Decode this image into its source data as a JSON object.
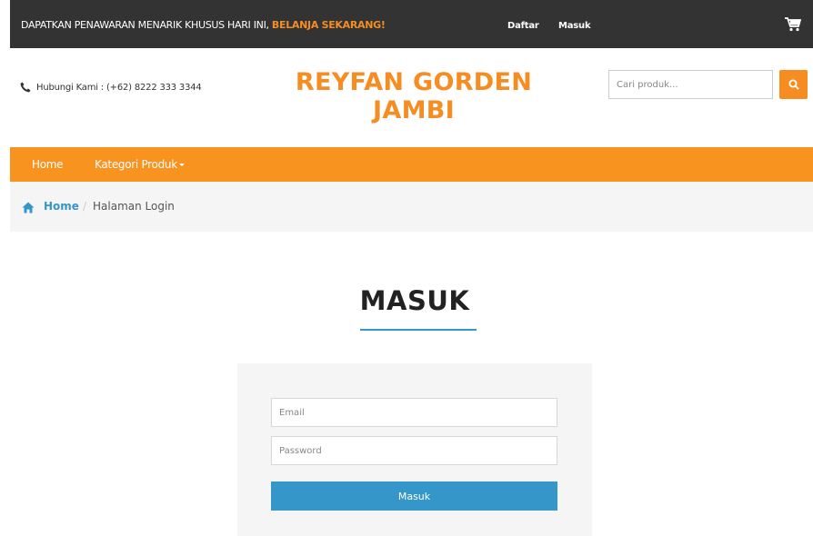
{
  "topbar": {
    "promo_text": "DAPATKAN PENAWARAN MENARIK KHUSUS HARI INI, ",
    "promo_cta": "BELANJA SEKARANG!",
    "register_label": "Daftar",
    "login_label": "Masuk",
    "cart_icon": "cart-icon"
  },
  "header": {
    "phone_icon": "phone-icon",
    "contact_text": "Hubungi Kami : (+62) 8222 333 3344",
    "brand_line1": "REYFAN GORDEN",
    "brand_line2": "JAMBI",
    "search_placeholder": "Cari produk...",
    "search_icon": "search-icon"
  },
  "nav": {
    "items": [
      {
        "label": "Home"
      },
      {
        "label": "Kategori Produk"
      }
    ]
  },
  "breadcrumb": {
    "home_label": "Home",
    "separator": "/",
    "current": "Halaman Login"
  },
  "login": {
    "title": "MASUK",
    "email_placeholder": "Email",
    "password_placeholder": "Password",
    "submit_label": "Masuk"
  },
  "colors": {
    "topbar": "#333333",
    "accent_orange": "#f58d22",
    "nav_orange": "#f8931f",
    "link_blue": "#3596c9",
    "panel_gray": "#f5f5f5"
  }
}
